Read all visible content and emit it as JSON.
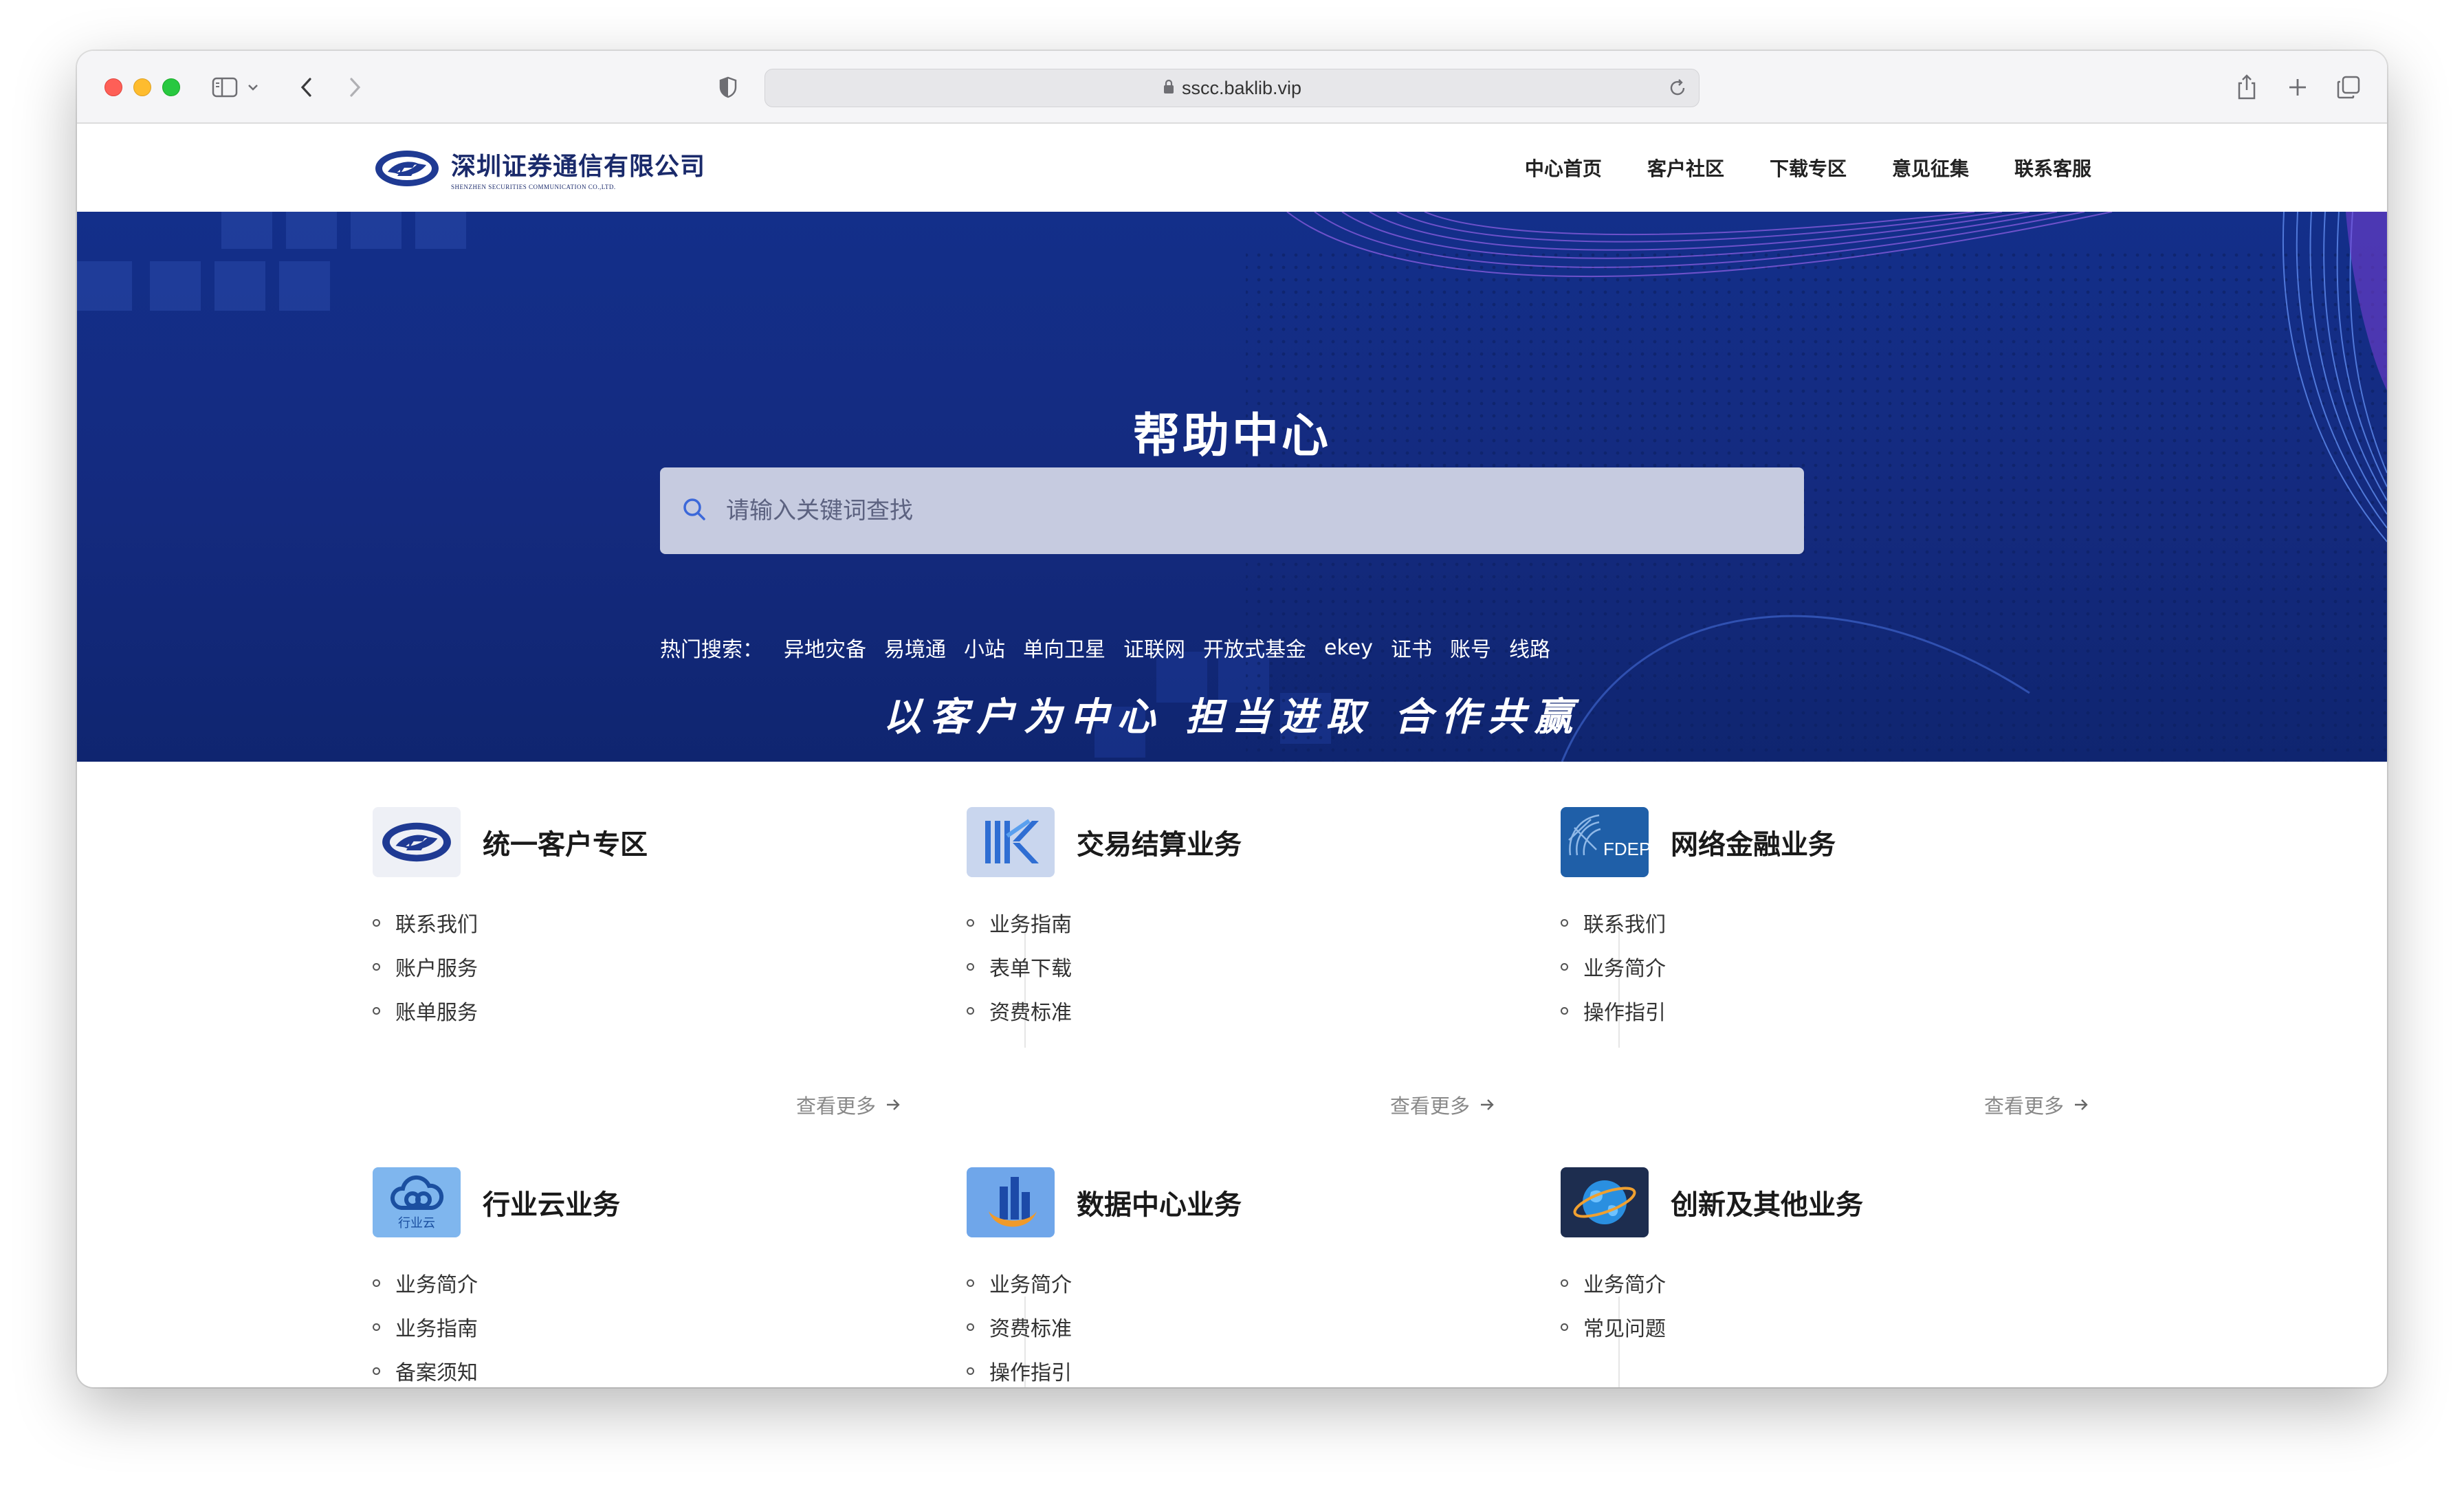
{
  "browser": {
    "address": "sscc.baklib.vip"
  },
  "header": {
    "logo_cn": "深圳证券通信有限公司",
    "logo_en": "SHENZHEN SECURITIES COMMUNICATION CO.,LTD.",
    "nav": [
      "中心首页",
      "客户社区",
      "下载专区",
      "意见征集",
      "联系客服"
    ]
  },
  "hero": {
    "title": "帮助中心",
    "search_placeholder": "请输入关键词查找",
    "hot_label": "热门搜索：",
    "hot_items": [
      "异地灾备",
      "易境通",
      "小站",
      "单向卫星",
      "证联网",
      "开放式基金",
      "ekey",
      "证书",
      "账号",
      "线路"
    ],
    "slogan": "以客户为中心 担当进取 合作共赢"
  },
  "categories": [
    {
      "title": "统一客户专区",
      "items": [
        "联系我们",
        "账户服务",
        "账单服务"
      ],
      "more": "查看更多"
    },
    {
      "title": "交易结算业务",
      "items": [
        "业务指南",
        "表单下载",
        "资费标准"
      ],
      "more": "查看更多"
    },
    {
      "title": "网络金融业务",
      "items": [
        "联系我们",
        "业务简介",
        "操作指引"
      ],
      "more": "查看更多"
    },
    {
      "title": "行业云业务",
      "items": [
        "业务简介",
        "业务指南",
        "备案须知"
      ],
      "logo_text": "行业云"
    },
    {
      "title": "数据中心业务",
      "items": [
        "业务简介",
        "资费标准",
        "操作指引"
      ]
    },
    {
      "title": "创新及其他业务",
      "items": [
        "业务简介",
        "常见问题"
      ]
    }
  ],
  "fdep_logo_text": "FDEP",
  "colors": {
    "hero_bg": "#142a7e",
    "search_bg": "#c6cbe0",
    "brand": "#1a2a6b"
  }
}
